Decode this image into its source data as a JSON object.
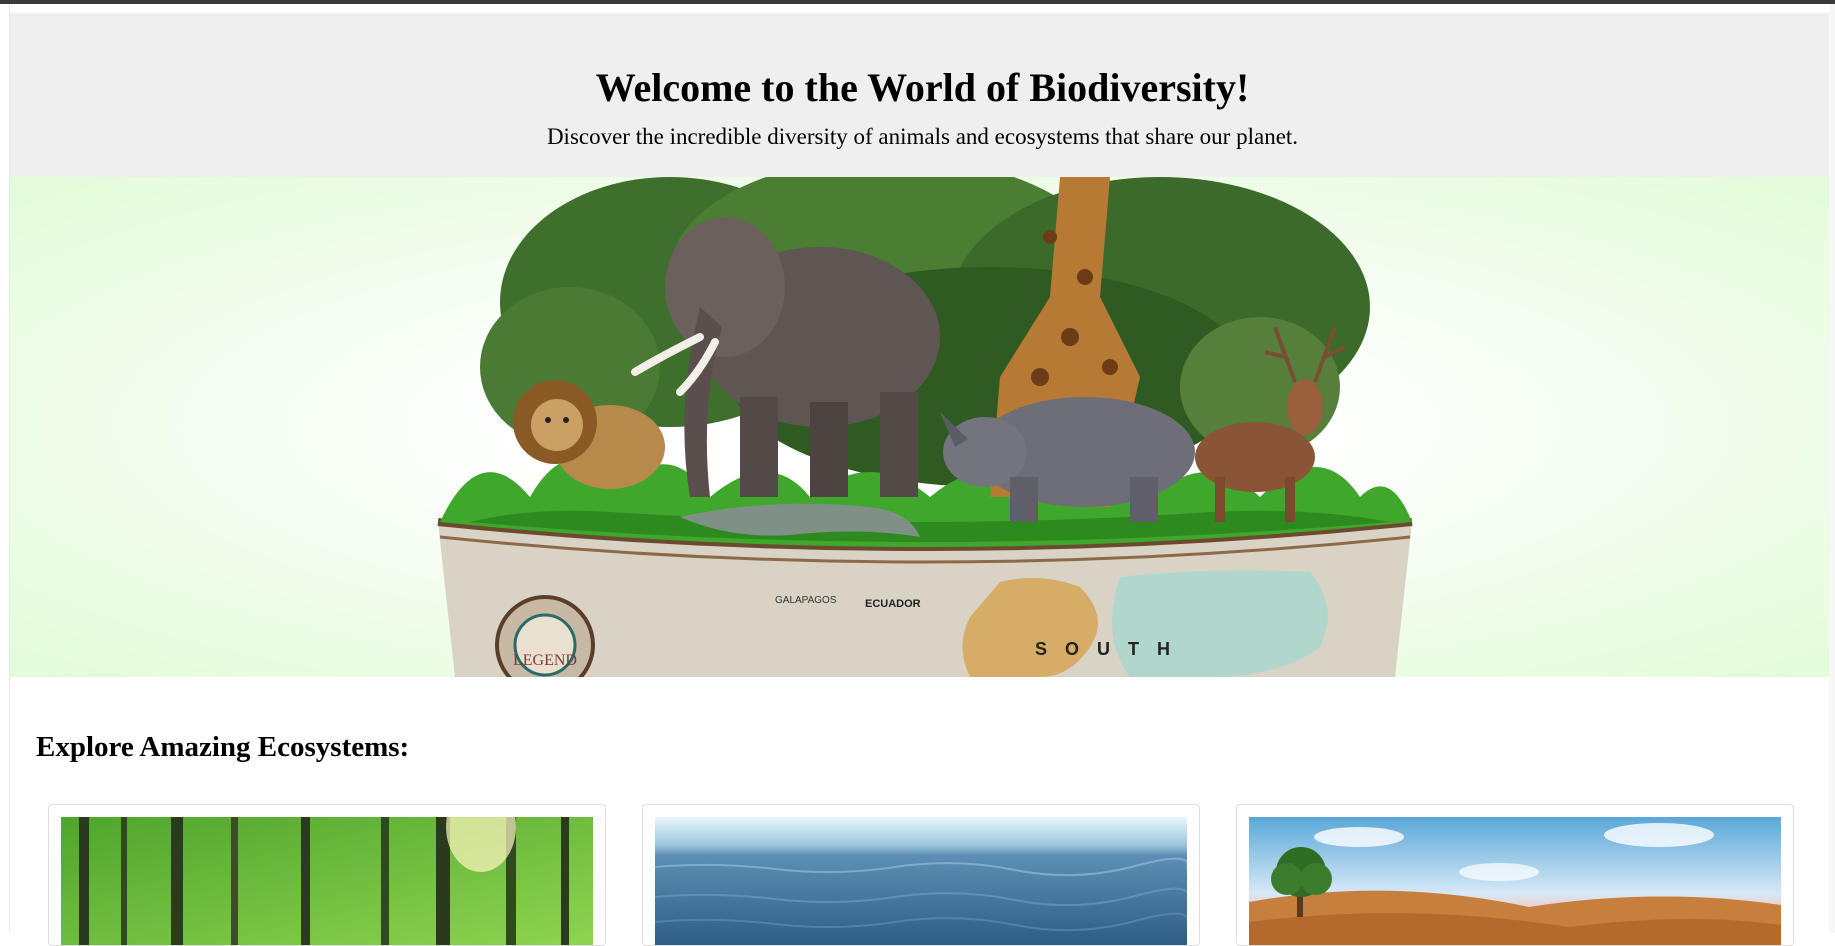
{
  "header": {
    "title": "Welcome to the World of Biodiversity!",
    "subtitle": "Discover the incredible diversity of animals and ecosystems that share our planet."
  },
  "hero": {
    "image_description": "Globe with lion, elephant, giraffe, rhino, deer and crocodile",
    "map_labels": [
      "GALAPAGOS",
      "ECUADOR",
      "SOUTH",
      "LEGEND"
    ]
  },
  "ecosystems": {
    "heading": "Explore Amazing Ecosystems:",
    "cards": [
      {
        "name": "forest",
        "image": "forest-image"
      },
      {
        "name": "ocean",
        "image": "ocean-image"
      },
      {
        "name": "desert",
        "image": "desert-image"
      }
    ]
  },
  "colors": {
    "header_bg": "#efefef",
    "hero_glow": "#e3fcd9"
  }
}
